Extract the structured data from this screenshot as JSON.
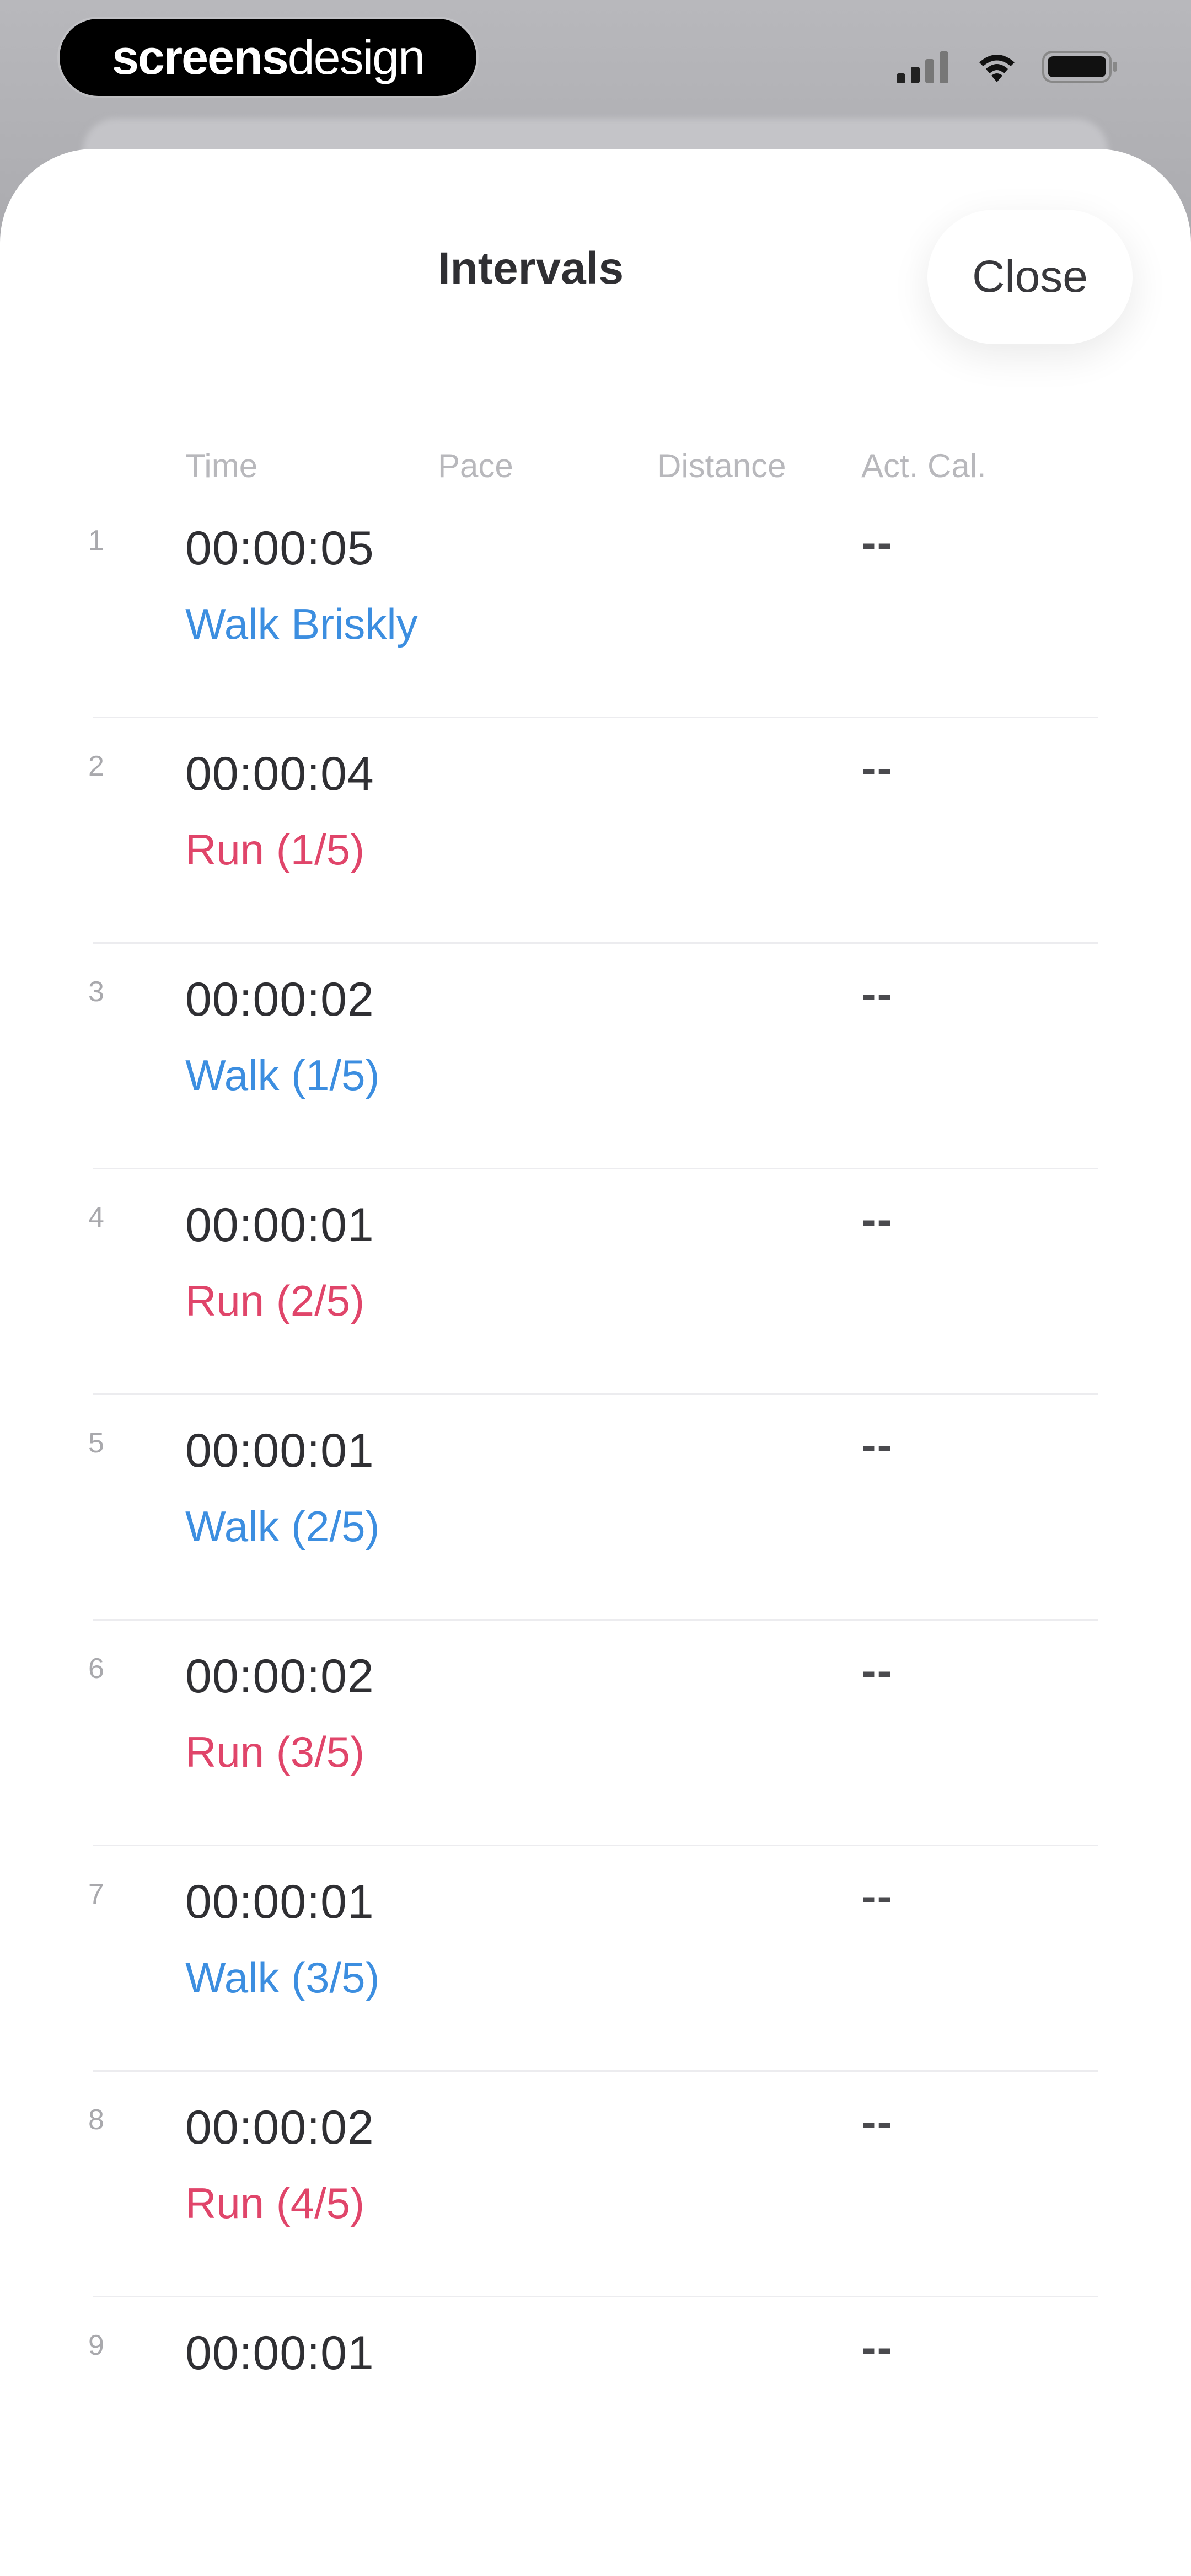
{
  "status_bar": {
    "brand_bold": "screens",
    "brand_light": "design",
    "signal_icon": "signal-icon",
    "wifi_icon": "wifi-icon",
    "battery_icon": "battery-icon"
  },
  "sheet": {
    "title": "Intervals",
    "close_label": "Close"
  },
  "columns": {
    "time": "Time",
    "pace": "Pace",
    "distance": "Distance",
    "cal": "Act. Cal."
  },
  "colors": {
    "walk": "#3c8ee0",
    "run": "#e0456a"
  },
  "intervals": [
    {
      "num": "1",
      "time": "00:00:05",
      "label": "Walk Briskly",
      "kind": "walk",
      "cal": "--"
    },
    {
      "num": "2",
      "time": "00:00:04",
      "label": "Run (1/5)",
      "kind": "run",
      "cal": "--"
    },
    {
      "num": "3",
      "time": "00:00:02",
      "label": "Walk (1/5)",
      "kind": "walk",
      "cal": "--"
    },
    {
      "num": "4",
      "time": "00:00:01",
      "label": "Run (2/5)",
      "kind": "run",
      "cal": "--"
    },
    {
      "num": "5",
      "time": "00:00:01",
      "label": "Walk (2/5)",
      "kind": "walk",
      "cal": "--"
    },
    {
      "num": "6",
      "time": "00:00:02",
      "label": "Run (3/5)",
      "kind": "run",
      "cal": "--"
    },
    {
      "num": "7",
      "time": "00:00:01",
      "label": "Walk (3/5)",
      "kind": "walk",
      "cal": "--"
    },
    {
      "num": "8",
      "time": "00:00:02",
      "label": "Run (4/5)",
      "kind": "run",
      "cal": "--"
    },
    {
      "num": "9",
      "time": "00:00:01",
      "label": "",
      "kind": "walk",
      "cal": "--"
    }
  ]
}
